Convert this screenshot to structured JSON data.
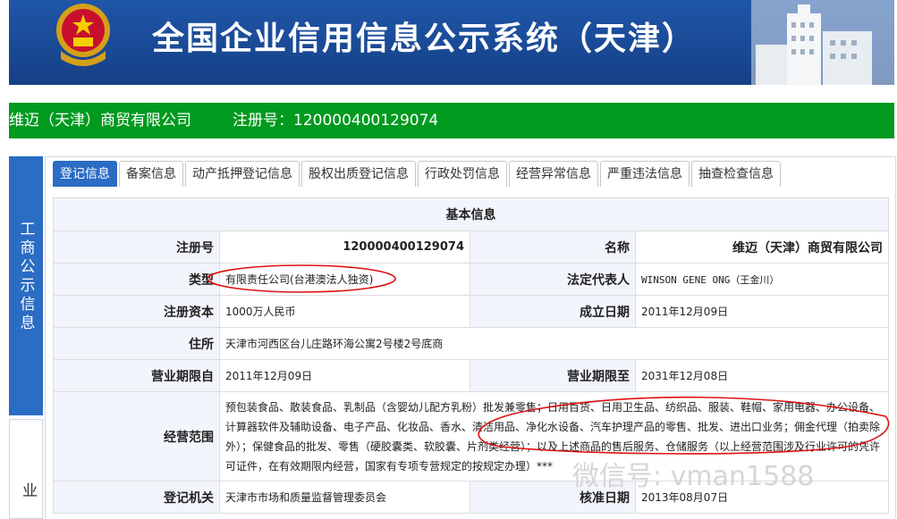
{
  "banner": {
    "title": "全国企业信用信息公示系统（天津）",
    "emblem_icon": "national-emblem-icon",
    "colors": {
      "background": "#1a4a96",
      "text": "#ffffff"
    }
  },
  "company_bar": {
    "name": "维迈（天津）商贸有限公司",
    "reg_label": "注册号：",
    "reg_no": "120000400129074",
    "color": "#009a1f"
  },
  "side_nav": {
    "active_label": "工商公示信息",
    "inactive_label": "企业"
  },
  "tabs": [
    {
      "label": "登记信息",
      "active": true
    },
    {
      "label": "备案信息",
      "active": false
    },
    {
      "label": "动产抵押登记信息",
      "active": false
    },
    {
      "label": "股权出质登记信息",
      "active": false
    },
    {
      "label": "行政处罚信息",
      "active": false
    },
    {
      "label": "经营异常信息",
      "active": false
    },
    {
      "label": "严重违法信息",
      "active": false
    },
    {
      "label": "抽查检查信息",
      "active": false
    }
  ],
  "basic_info": {
    "heading": "基本信息",
    "reg_no_label": "注册号",
    "reg_no": "120000400129074",
    "name_label": "名称",
    "name": "维迈（天津）商贸有限公司",
    "type_label": "类型",
    "type": "有限责任公司(台港澳法人独资)",
    "legal_rep_label": "法定代表人",
    "legal_rep": "WINSON GENE ONG（王金川）",
    "capital_label": "注册资本",
    "capital": "1000万人民币",
    "established_label": "成立日期",
    "established": "2011年12月09日",
    "address_label": "住所",
    "address": "天津市河西区台儿庄路环海公寓2号楼2号底商",
    "term_from_label": "营业期限自",
    "term_from": "2011年12月09日",
    "term_to_label": "营业期限至",
    "term_to": "2031年12月08日",
    "scope_label": "经营范围",
    "scope": "预包装食品、散装食品、乳制品（含婴幼儿配方乳粉）批发兼零售；日用百货、日用卫生品、纺织品、服装、鞋帽、家用电器、办公设备、计算器软件及辅助设备、电子产品、化妆品、香水、清洁用品、净化水设备、汽车护理产品的零售、批发、进出口业务；佣金代理（拍卖除外）；保健食品的批发、零售（硬胶囊类、软胶囊、片剂类经营）；以及上述商品的售后服务、仓储服务（以上经营范围涉及行业许可的凭许可证件，在有效期限内经营，国家有专项专营规定的按规定办理）***",
    "authority_label": "登记机关",
    "authority": "天津市市场和质量监督管理委员会",
    "approved_label": "核准日期",
    "approved": "2013年08月07日"
  },
  "watermark": "微信号: vman1588"
}
